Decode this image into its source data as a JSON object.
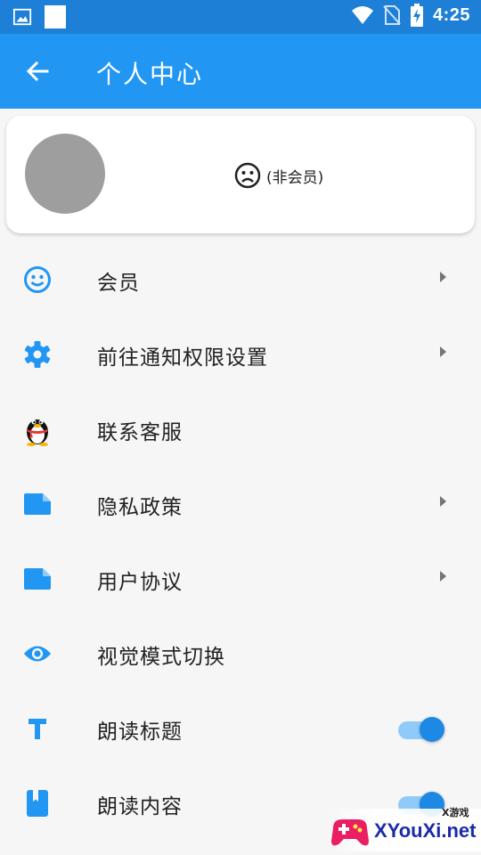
{
  "status_bar": {
    "time": "4:25",
    "icons": [
      "image-icon",
      "notification-square-icon",
      "wifi-icon",
      "no-sim-icon",
      "battery-charging-icon"
    ]
  },
  "app_bar": {
    "title": "个人中心",
    "back_icon": "arrow-left-icon"
  },
  "profile": {
    "status_icon": "sad-face-icon",
    "member_status": "(非会员)"
  },
  "menu": {
    "items": [
      {
        "label": "会员",
        "icon": "smiley-icon"
      },
      {
        "label": "前往通知权限设置",
        "icon": "gear-icon"
      },
      {
        "label": "联系客服",
        "icon": "qq-penguin-icon"
      },
      {
        "label": "隐私政策",
        "icon": "document-icon"
      },
      {
        "label": "用户协议",
        "icon": "document-icon"
      },
      {
        "label": "视觉模式切换",
        "icon": "eye-icon"
      },
      {
        "label": "朗读标题",
        "icon": "text-icon",
        "toggle": true
      },
      {
        "label": "朗读内容",
        "icon": "book-icon",
        "toggle": true
      }
    ]
  },
  "watermark": {
    "site": "XYouXi.net",
    "tag": "X游戏"
  },
  "colors": {
    "status_bar": "#1d7fd6",
    "app_bar": "#2196f3",
    "icon_blue": "#2196f3",
    "toggle_on": "#1e88e5"
  }
}
